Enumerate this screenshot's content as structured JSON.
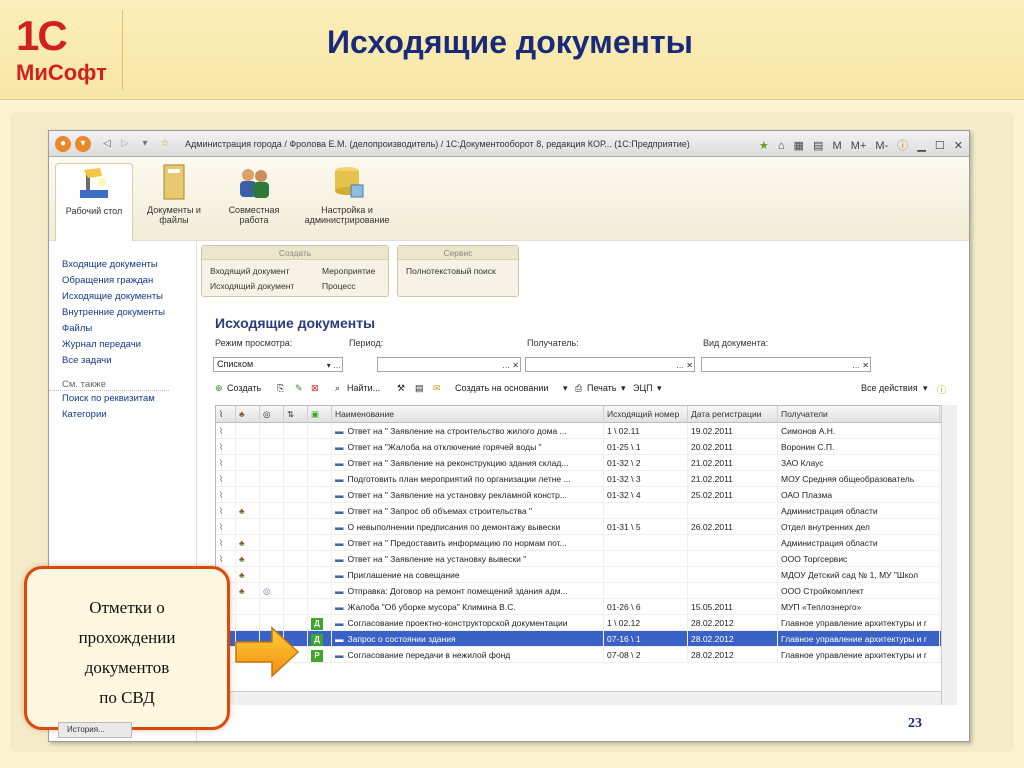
{
  "slide": {
    "title": "Исходящие документы",
    "logo_top": "1С",
    "logo_bottom": "МиСофт",
    "page_number": "23"
  },
  "window": {
    "title": "Администрация города / Фролова Е.М. (делопроизводитель) / 1С:Документооборот 8, редакция КОР... (1С:Предприятие)",
    "calc_m": "M",
    "calc_mplus": "M+",
    "calc_mminus": "M-"
  },
  "sections": [
    {
      "label": "Рабочий стол"
    },
    {
      "label": "Документы и файлы"
    },
    {
      "label": "Совместная работа"
    },
    {
      "label": "Настройка и администрирование"
    }
  ],
  "sidebar": {
    "items": [
      "Входящие документы",
      "Обращения граждан",
      "Исходящие документы",
      "Внутренние документы",
      "Файлы",
      "Журнал передачи",
      "Все задачи"
    ],
    "see_also_title": "См. также",
    "see_also": [
      "Поиск по реквизитам",
      "Категории"
    ]
  },
  "commands": {
    "create_title": "Создать",
    "create_items": [
      "Входящий документ",
      "Исходящий документ",
      "Мероприятие",
      "Процесс"
    ],
    "service_title": "Сервис",
    "service_items": [
      "Полнотекстовый поиск"
    ]
  },
  "form": {
    "title": "Исходящие документы",
    "filters": {
      "mode_label": "Режим просмотра:",
      "mode_value": "Списком",
      "period_label": "Период:",
      "recipient_label": "Получатель:",
      "doctype_label": "Вид документа:"
    },
    "toolbar": {
      "create": "Создать",
      "find": "Найти...",
      "create_based": "Создать на основании",
      "print": "Печать",
      "esign": "ЭЦП",
      "all_actions": "Все действия"
    }
  },
  "table": {
    "columns": [
      "Наименование",
      "Исходящий номер",
      "Дата регистрации",
      "Получатели"
    ],
    "rows": [
      {
        "name": "Ответ на \" Заявление на строительство жилого дома ...",
        "number": "1 \\ 02.11",
        "date": "19.02.2011",
        "recipient": "Симонов А.Н.",
        "group": false,
        "doc": false,
        "mark": ""
      },
      {
        "name": "Ответ на \"Жалоба на отключение горячей воды \"",
        "number": "01-25 \\ 1",
        "date": "20.02.2011",
        "recipient": "Воронин С.П.",
        "group": false,
        "doc": false,
        "mark": ""
      },
      {
        "name": "Ответ на \" Заявление на реконструкцию здания склад...",
        "number": "01-32 \\ 2",
        "date": "21.02.2011",
        "recipient": "ЗАО Клаус",
        "group": false,
        "doc": false,
        "mark": ""
      },
      {
        "name": "Подготовить план мероприятий по организации летне ...",
        "number": "01-32 \\ 3",
        "date": "21.02.2011",
        "recipient": "МОУ Средняя общеобразователь",
        "group": false,
        "doc": false,
        "mark": ""
      },
      {
        "name": "Ответ на \" Заявление на установку рекламной констр...",
        "number": "01-32 \\ 4",
        "date": "25.02.2011",
        "recipient": "ОАО Плазма",
        "group": false,
        "doc": false,
        "mark": ""
      },
      {
        "name": "Ответ на \" Запрос об объемах строительства \"",
        "number": "",
        "date": "",
        "recipient": "Администрация области",
        "group": true,
        "doc": false,
        "mark": ""
      },
      {
        "name": "О невыполнении предписания по демонтажу вывески",
        "number": "01-31 \\ 5",
        "date": "26.02.2011",
        "recipient": "Отдел внутренних дел",
        "group": false,
        "doc": false,
        "mark": ""
      },
      {
        "name": "Ответ на \" Предоставить информацию по нормам пот...",
        "number": "",
        "date": "",
        "recipient": "Администрация области",
        "group": true,
        "doc": false,
        "mark": ""
      },
      {
        "name": "Ответ на \" Заявление на установку вывески \"",
        "number": "",
        "date": "",
        "recipient": "ООО Торгсервис",
        "group": true,
        "doc": false,
        "mark": ""
      },
      {
        "name": "Приглашение на совещание",
        "number": "",
        "date": "",
        "recipient": "МДОУ Детский сад № 1, МУ \"Школ",
        "group": true,
        "doc": false,
        "mark": ""
      },
      {
        "name": "Отправка: Договор на ремонт помещений здания адм...",
        "number": "",
        "date": "",
        "recipient": "ООО Стройкомплект",
        "group": true,
        "doc": true,
        "mark": ""
      },
      {
        "name": "Жалоба \"Об уборке мусора\" Климина В.С.",
        "number": "01-26 \\ 6",
        "date": "15.05.2011",
        "recipient": "МУП «Теплоэнерго»",
        "group": false,
        "doc": false,
        "mark": ""
      },
      {
        "name": "Согласование проектно-конструкторской документации",
        "number": "1 \\ 02.12",
        "date": "28.02.2012",
        "recipient": "Главное управление архитектуры и г",
        "group": false,
        "doc": false,
        "mark": "Д"
      },
      {
        "name": "Запрос о состоянии здания",
        "number": "07-16 \\ 1",
        "date": "28.02.2012",
        "recipient": "Главное управление архитектуры и г",
        "group": false,
        "doc": false,
        "mark": "Д",
        "selected": true
      },
      {
        "name": "Согласование передачи в нежилой фонд",
        "number": "07-08 \\ 2",
        "date": "28.02.2012",
        "recipient": "Главное управление архитектуры и г",
        "group": false,
        "doc": false,
        "mark": "Р"
      }
    ]
  },
  "callout": {
    "lines": [
      "Отметки о",
      "прохождении",
      "документов",
      "по СВД"
    ]
  },
  "status_tab": "История...",
  "colors": {
    "title": "#1a2a7a",
    "accent": "#d21f1f",
    "selection": "#3a62c6",
    "callout_border": "#d94b0c",
    "mark_green": "#3fa52b"
  }
}
